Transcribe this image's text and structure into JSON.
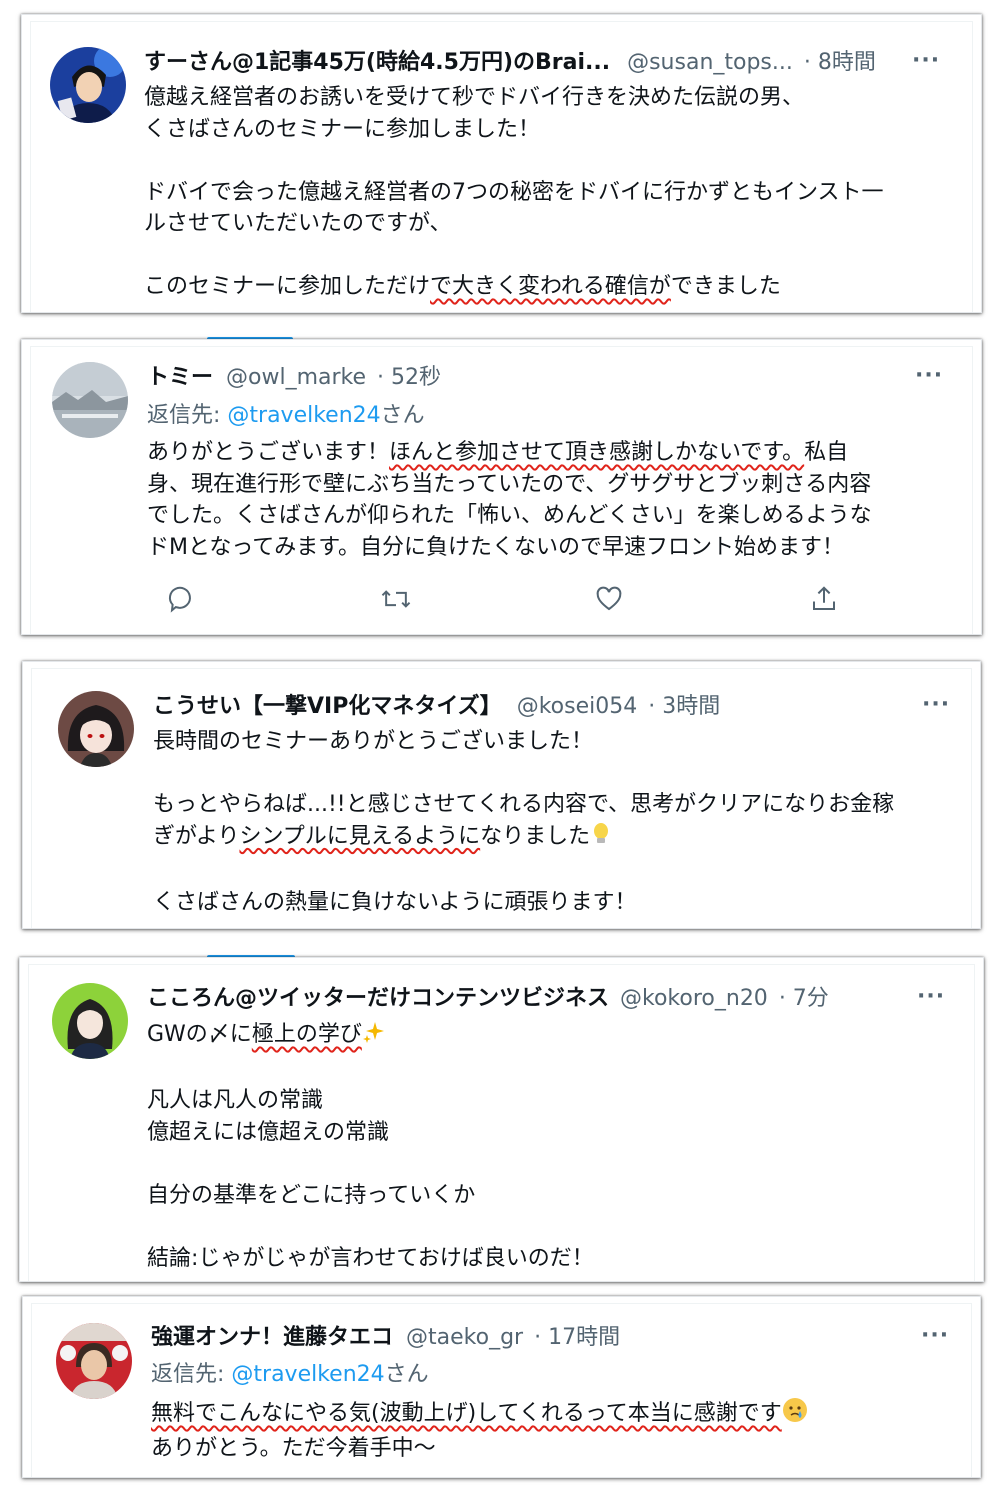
{
  "tweets": [
    {
      "name": "すーさん@1記事45万(時給4.5万円)のBrai...",
      "handle": "@susan_tops...",
      "time": "· 8時間",
      "avatar_icon": "avatar-anime-man-icon",
      "body": [
        "億越え経営者のお誘いを受けて秒でドバイ行きを決めた伝説の男、",
        "くさばさんのセミナーに参加しました！",
        "",
        "ドバイで会った億越え経営者の7つの秘密をドバイに行かずともインスト一",
        "ルさせていただいたのですが、",
        "",
        "このセミナーに参加しただけ",
        "で大きく変われる確信が",
        "できました"
      ]
    },
    {
      "name": "トミー",
      "handle": "@owl_marke",
      "time": "· 52秒",
      "avatar_icon": "avatar-landscape-icon",
      "reply_prefix": "返信先: ",
      "reply_mention": "@travelken24",
      "reply_suffix": "さん",
      "body": [
        "ありがとうございます！",
        "ほんと参加させて頂き感謝しかないです。",
        "私自",
        "身、現在進行形で壁にぶち当たっていたので、グサグサとブッ刺さる内容",
        "でした。くさばさんが仰られた「怖い、めんどくさい」を楽しめるような",
        "ドMとなってみます。自分に負けたくないので早速フロント始めます！"
      ]
    },
    {
      "name": "こうせい【一撃VIP化マネタイズ】",
      "handle": "@kosei054",
      "time": "· 3時間",
      "avatar_icon": "avatar-anime-girl-icon",
      "body": [
        "長時間のセミナーありがとうございました！",
        "",
        "もっとやらねば...!!と感じさせてくれる内容で、思考がクリアになりお金稼",
        "ぎがより",
        "シンプルに見えるように",
        "なりました",
        "",
        "くさばさんの熱量に負けないように頑張ります！"
      ]
    },
    {
      "name": "こころん@ツイッターだけコンテンツビジネス",
      "handle": "@kokoro_n20",
      "time": "· 7分",
      "avatar_icon": "avatar-woman-illustration-icon",
      "body": [
        "GWの〆に",
        "極上の学び",
        "",
        "凡人は凡人の常識",
        "億超えには億超えの常識",
        "",
        "自分の基準をどこに持っていくか",
        "",
        "結論:じゃがじゃが言わせておけば良いのだ！"
      ]
    },
    {
      "name": "強運オンナ！進藤タエコ",
      "handle": "@taeko_gr",
      "time": "· 17時間",
      "avatar_icon": "avatar-photo-woman-icon",
      "reply_prefix": "返信先: ",
      "reply_mention": "@travelken24",
      "reply_suffix": "さん",
      "body": [
        "無料でこんなにやる気(波動上げ)してくれるって本当に感謝です",
        "ありがとう。ただ今着手中〜"
      ]
    }
  ],
  "more_label": "···",
  "actions": [
    "reply-icon",
    "retweet-icon",
    "like-icon",
    "share-icon"
  ],
  "colors": {
    "link": "#1d9bf0",
    "underline": "#e0241b",
    "secondary": "#536471"
  }
}
